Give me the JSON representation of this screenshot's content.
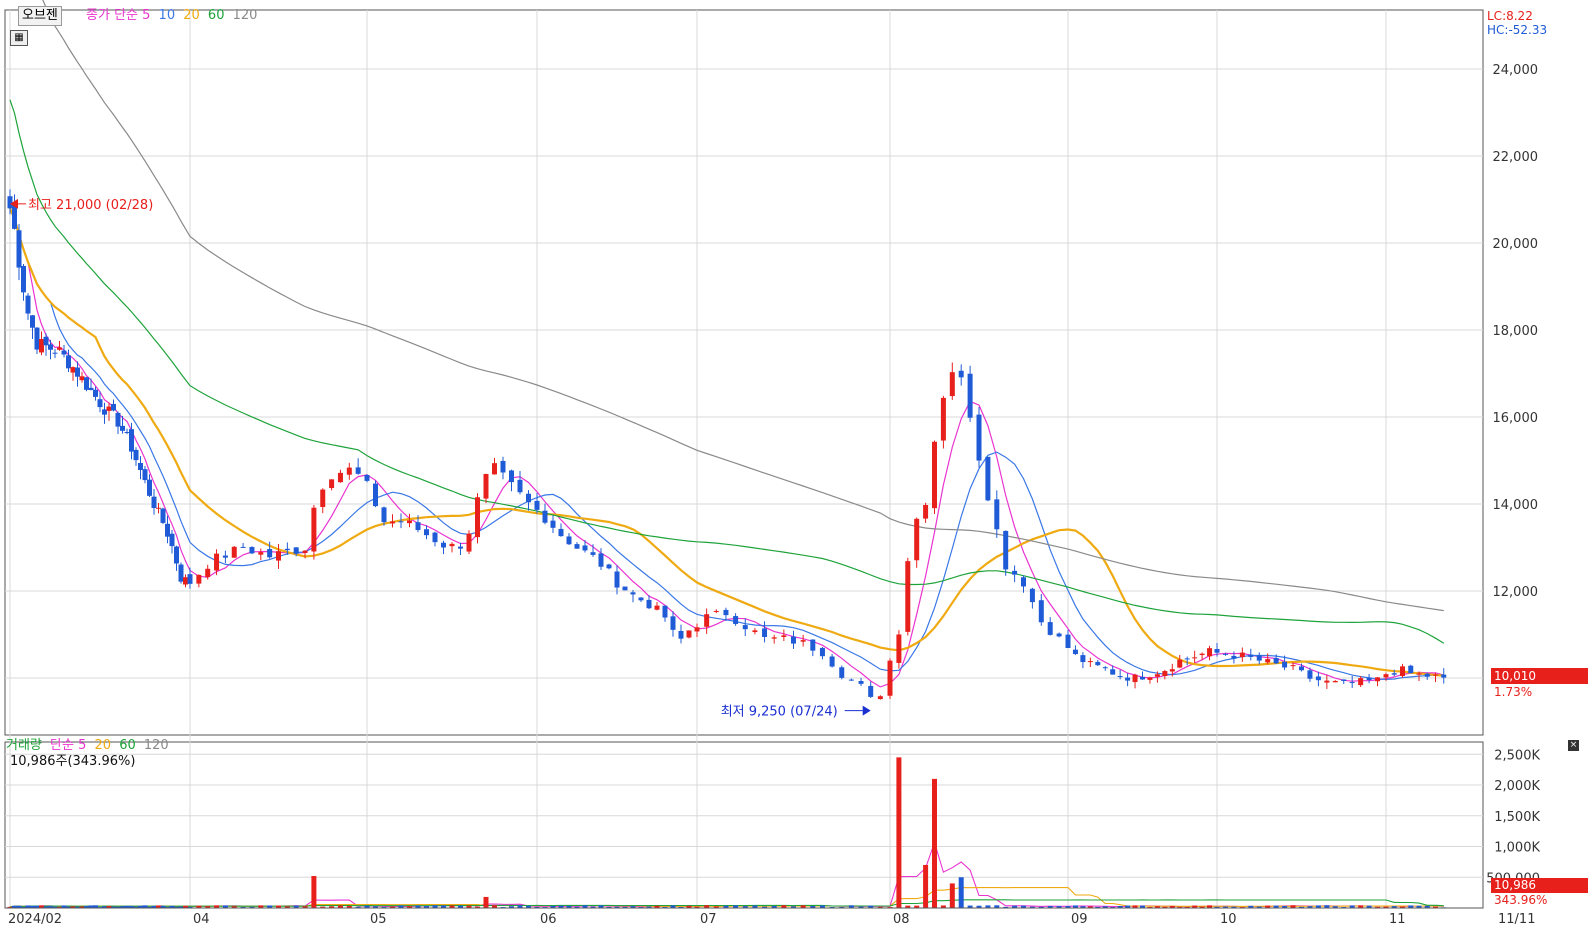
{
  "price_panel": {
    "selector_label": "오브젠",
    "legend": {
      "series": "종가",
      "ma_type": "단순",
      "periods": [
        "5",
        "10",
        "20",
        "60",
        "120"
      ]
    },
    "info": {
      "lc": "LC:8.22",
      "hc": "HC:-52.33"
    },
    "current_price": "10,010",
    "current_change": "1.73%",
    "high_label": "최고 21,000 (02/28)",
    "low_label": "최저 9,250 (07/24)"
  },
  "volume_panel": {
    "legend": {
      "series": "거래량",
      "ma_type": "단순",
      "periods": [
        "5",
        "20",
        "60",
        "120"
      ]
    },
    "summary": "10,986주(343.96%)",
    "current_volume": "10,986",
    "current_ratio": "343.96%"
  },
  "colors": {
    "up": "#e8201c",
    "down": "#1f5bd6",
    "ma5": "#ea34d0",
    "ma10": "#3a78e6",
    "ma20": "#efaa12",
    "ma60": "#1ea33a",
    "ma120": "#8a8a8a",
    "grid": "#d8d8d8",
    "axis_text": "#333333"
  },
  "chart_data": [
    {
      "type": "candlestick",
      "title": "오브젠",
      "x_ticks": [
        "2024/02",
        "04",
        "05",
        "06",
        "07",
        "08",
        "09",
        "10",
        "11",
        "11/11"
      ],
      "y_ticks": [
        "12,000",
        "14,000",
        "16,000",
        "18,000",
        "20,000",
        "22,000",
        "24,000"
      ],
      "y_range": [
        8500,
        25000
      ],
      "x_range_month": [
        1.95,
        11.42
      ],
      "last_price": 10010,
      "anchors": [
        [
          2.0,
          20800
        ],
        [
          2.05,
          20300
        ],
        [
          2.12,
          19300
        ],
        [
          2.2,
          18400
        ],
        [
          2.3,
          17700
        ],
        [
          2.42,
          17600
        ],
        [
          2.55,
          17500
        ],
        [
          2.72,
          17100
        ],
        [
          2.9,
          16600
        ],
        [
          3.05,
          16200
        ],
        [
          3.2,
          15900
        ],
        [
          3.35,
          15300
        ],
        [
          3.5,
          14500
        ],
        [
          3.62,
          13900
        ],
        [
          3.72,
          13500
        ],
        [
          3.82,
          12900
        ],
        [
          3.9,
          12300
        ],
        [
          4.0,
          12200
        ],
        [
          4.12,
          12700
        ],
        [
          4.3,
          13000
        ],
        [
          4.45,
          12800
        ],
        [
          4.55,
          12900
        ],
        [
          4.65,
          13000
        ],
        [
          4.72,
          14300
        ],
        [
          4.8,
          14700
        ],
        [
          4.92,
          14800
        ],
        [
          5.0,
          14400
        ],
        [
          5.1,
          13600
        ],
        [
          5.22,
          13600
        ],
        [
          5.35,
          13300
        ],
        [
          5.48,
          13000
        ],
        [
          5.58,
          13100
        ],
        [
          5.68,
          14500
        ],
        [
          5.75,
          14800
        ],
        [
          5.85,
          14400
        ],
        [
          5.95,
          14000
        ],
        [
          6.05,
          13700
        ],
        [
          6.15,
          13300
        ],
        [
          6.25,
          13000
        ],
        [
          6.38,
          12700
        ],
        [
          6.5,
          12200
        ],
        [
          6.6,
          11900
        ],
        [
          6.7,
          11700
        ],
        [
          6.8,
          11400
        ],
        [
          6.88,
          10800
        ],
        [
          6.95,
          11100
        ],
        [
          7.05,
          11400
        ],
        [
          7.15,
          11500
        ],
        [
          7.25,
          11200
        ],
        [
          7.35,
          10900
        ],
        [
          7.45,
          10900
        ],
        [
          7.55,
          10800
        ],
        [
          7.65,
          10600
        ],
        [
          7.75,
          10100
        ],
        [
          7.85,
          9800
        ],
        [
          7.9,
          9500
        ],
        [
          7.95,
          9650
        ],
        [
          8.0,
          10400
        ],
        [
          8.05,
          11100
        ],
        [
          8.12,
          13400
        ],
        [
          8.2,
          14100
        ],
        [
          8.28,
          16300
        ],
        [
          8.35,
          17100
        ],
        [
          8.42,
          16700
        ],
        [
          8.5,
          15100
        ],
        [
          8.58,
          13700
        ],
        [
          8.65,
          12600
        ],
        [
          8.75,
          12200
        ],
        [
          8.85,
          11300
        ],
        [
          8.95,
          10900
        ],
        [
          9.05,
          10500
        ],
        [
          9.15,
          10300
        ],
        [
          9.25,
          10200
        ],
        [
          9.35,
          10050
        ],
        [
          9.45,
          10000
        ],
        [
          9.55,
          10100
        ],
        [
          9.65,
          10200
        ],
        [
          9.75,
          10400
        ],
        [
          9.85,
          10500
        ],
        [
          9.95,
          10600
        ],
        [
          10.05,
          10550
        ],
        [
          10.15,
          10500
        ],
        [
          10.25,
          10400
        ],
        [
          10.35,
          10300
        ],
        [
          10.45,
          10200
        ],
        [
          10.55,
          10000
        ],
        [
          10.65,
          9900
        ],
        [
          10.75,
          9850
        ],
        [
          10.85,
          9900
        ],
        [
          10.95,
          9950
        ],
        [
          11.0,
          10100
        ],
        [
          11.08,
          10200
        ],
        [
          11.15,
          10100
        ],
        [
          11.25,
          10050
        ],
        [
          11.35,
          10010
        ]
      ]
    },
    {
      "type": "bar",
      "title": "거래량",
      "y_ticks": [
        "500,000",
        "1,000K",
        "1,500K",
        "2,000K",
        "2,500K"
      ],
      "y_range": [
        0,
        2700000
      ],
      "spikes": [
        [
          4.72,
          520000
        ],
        [
          5.68,
          180000
        ],
        [
          8.07,
          2450000
        ],
        [
          8.2,
          700000
        ],
        [
          8.25,
          2100000
        ],
        [
          8.33,
          400000
        ],
        [
          8.38,
          500000
        ]
      ],
      "last_volume": 10986
    }
  ]
}
